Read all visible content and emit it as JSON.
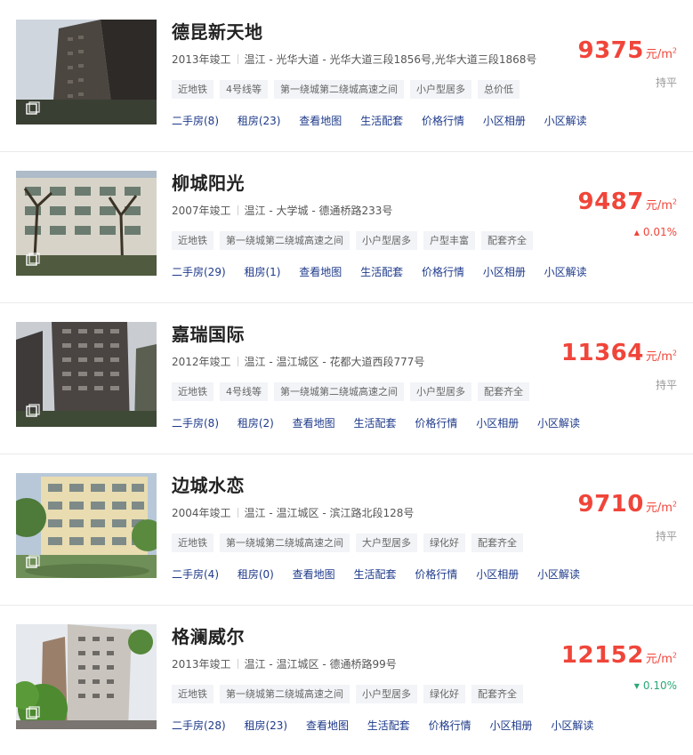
{
  "communities": [
    {
      "name": "德昆新天地",
      "year": "2013年竣工",
      "address": "温江 - 光华大道 - 光华大道三段1856号,光华大道三段1868号",
      "tags": [
        "近地铁",
        "4号线等",
        "第一绕城第二绕城高速之间",
        "小户型居多",
        "总价低"
      ],
      "links": [
        "二手房(8)",
        "租房(23)",
        "查看地图",
        "生活配套",
        "价格行情",
        "小区相册",
        "小区解读"
      ],
      "price": "9375",
      "unit": "元/m",
      "trend_dir": "flat",
      "trend_text": "持平",
      "arrow": ""
    },
    {
      "name": "柳城阳光",
      "year": "2007年竣工",
      "address": "温江 - 大学城 - 德通桥路233号",
      "tags": [
        "近地铁",
        "第一绕城第二绕城高速之间",
        "小户型居多",
        "户型丰富",
        "配套齐全"
      ],
      "links": [
        "二手房(29)",
        "租房(1)",
        "查看地图",
        "生活配套",
        "价格行情",
        "小区相册",
        "小区解读"
      ],
      "price": "9487",
      "unit": "元/m",
      "trend_dir": "up",
      "trend_text": "0.01%",
      "arrow": "▲"
    },
    {
      "name": "嘉瑞国际",
      "year": "2012年竣工",
      "address": "温江 - 温江城区 - 花都大道西段777号",
      "tags": [
        "近地铁",
        "4号线等",
        "第一绕城第二绕城高速之间",
        "小户型居多",
        "配套齐全"
      ],
      "links": [
        "二手房(8)",
        "租房(2)",
        "查看地图",
        "生活配套",
        "价格行情",
        "小区相册",
        "小区解读"
      ],
      "price": "11364",
      "unit": "元/m",
      "trend_dir": "flat",
      "trend_text": "持平",
      "arrow": ""
    },
    {
      "name": "边城水恋",
      "year": "2004年竣工",
      "address": "温江 - 温江城区 - 滨江路北段128号",
      "tags": [
        "近地铁",
        "第一绕城第二绕城高速之间",
        "大户型居多",
        "绿化好",
        "配套齐全"
      ],
      "links": [
        "二手房(4)",
        "租房(0)",
        "查看地图",
        "生活配套",
        "价格行情",
        "小区相册",
        "小区解读"
      ],
      "price": "9710",
      "unit": "元/m",
      "trend_dir": "flat",
      "trend_text": "持平",
      "arrow": ""
    },
    {
      "name": "格澜威尔",
      "year": "2013年竣工",
      "address": "温江 - 温江城区 - 德通桥路99号",
      "tags": [
        "近地铁",
        "第一绕城第二绕城高速之间",
        "小户型居多",
        "绿化好",
        "配套齐全"
      ],
      "links": [
        "二手房(28)",
        "租房(23)",
        "查看地图",
        "生活配套",
        "价格行情",
        "小区相册",
        "小区解读"
      ],
      "price": "12152",
      "unit": "元/m",
      "trend_dir": "down",
      "trend_text": "0.10%",
      "arrow": "▼"
    }
  ],
  "unit_superscript": "2",
  "colors": {
    "price": "#f0453a",
    "link": "#1e3a8a",
    "down": "#2aa876"
  },
  "icons": {
    "thumbnail_badge": "image-gallery-icon"
  }
}
